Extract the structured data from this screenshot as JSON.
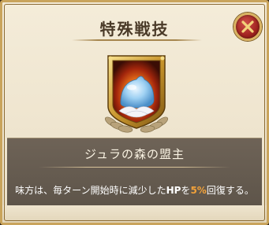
{
  "dialog": {
    "title": "特殊戦技"
  },
  "close_button": {
    "icon": "close-icon"
  },
  "emblem": {
    "icon": "slime-emblem-icon"
  },
  "skill": {
    "name": "ジュラの森の盟主",
    "description_prefix": "味方は、毎ターン開始時に減少した",
    "description_hp": "HP",
    "description_mid": "を",
    "description_value": "5%",
    "description_suffix": "回復する。"
  },
  "colors": {
    "frame_gold": "#c9a45c",
    "panel": "#5d5449",
    "value_highlight": "#f2a23a",
    "close_red": "#a0231f"
  }
}
